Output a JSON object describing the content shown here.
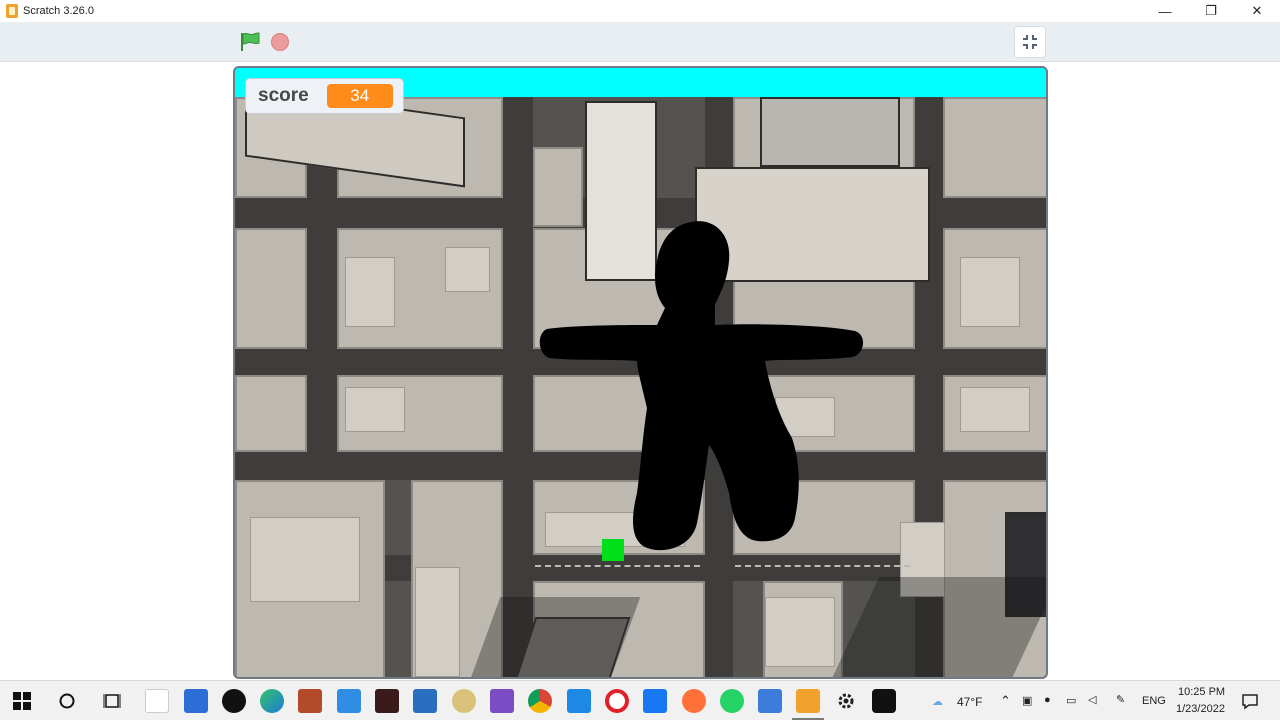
{
  "window": {
    "title": "Scratch 3.26.0",
    "minimize": "—",
    "restore": "❐",
    "close": "✕"
  },
  "toolbar": {
    "green_flag_icon": "green-flag-icon",
    "stop_icon": "stop-icon",
    "fullscreen_icon": "exit-fullscreen-icon"
  },
  "stage": {
    "score_label": "score",
    "score_value": "34",
    "top_bar_color": "#00ffff",
    "monitor_value_color": "#ff8c1a",
    "item_color": "#00e01a"
  },
  "taskbar": {
    "weather": "47°F",
    "language": "ENG",
    "time": "10:25 PM",
    "date": "1/23/2022",
    "apps": [
      "start",
      "search",
      "task-view",
      "notepad",
      "store",
      "tiktok",
      "edge",
      "photos",
      "phone",
      "capcut",
      "mail",
      "disc",
      "visual-studio",
      "chrome",
      "browser",
      "opera",
      "facebook",
      "firefox",
      "whatsapp",
      "paint",
      "scratch",
      "settings",
      "recorder"
    ]
  }
}
